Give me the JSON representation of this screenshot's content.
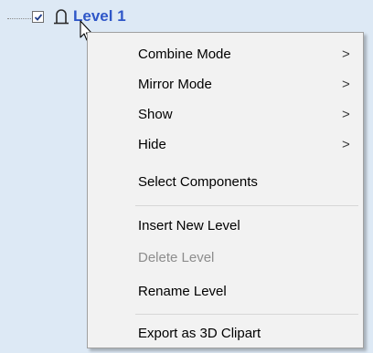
{
  "tree": {
    "level_label": "Level 1",
    "checkbox_checked": true,
    "level_icon": "arch-icon"
  },
  "context_menu": {
    "items": [
      {
        "label": "Combine Mode",
        "submenu": true,
        "enabled": true
      },
      {
        "label": "Mirror Mode",
        "submenu": true,
        "enabled": true
      },
      {
        "label": "Show",
        "submenu": true,
        "enabled": true
      },
      {
        "label": "Hide",
        "submenu": true,
        "enabled": true
      },
      {
        "label": "Select Components",
        "submenu": false,
        "enabled": true
      },
      {
        "label": "Insert New Level",
        "submenu": false,
        "enabled": true
      },
      {
        "label": "Delete Level",
        "submenu": false,
        "enabled": false
      },
      {
        "label": "Rename Level",
        "submenu": false,
        "enabled": true
      },
      {
        "label": "Export as 3D Clipart",
        "submenu": false,
        "enabled": true
      }
    ],
    "submenu_arrow": ">"
  },
  "colors": {
    "level_label": "#2f57c8",
    "tree_background": "#dde9f5",
    "menu_background": "#f2f2f2",
    "disabled_text": "#8d8d8d"
  }
}
